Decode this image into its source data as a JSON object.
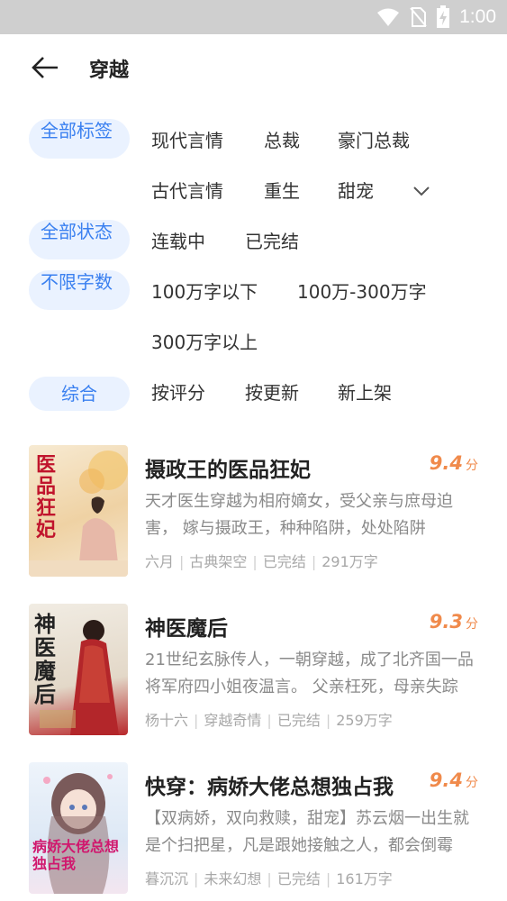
{
  "status_bar": {
    "time": "1:00"
  },
  "header": {
    "title": "穿越"
  },
  "filters": {
    "tags": {
      "label": "全部标签",
      "options": [
        "现代言情",
        "总裁",
        "豪门总裁",
        "古代言情",
        "重生",
        "甜宠"
      ]
    },
    "status": {
      "label": "全部状态",
      "options": [
        "连载中",
        "已完结"
      ]
    },
    "words": {
      "label": "不限字数",
      "options": [
        "100万字以下",
        "100万-300万字",
        "300万字以上"
      ]
    },
    "sort": {
      "label": "综合",
      "options": [
        "按评分",
        "按更新",
        "新上架"
      ]
    }
  },
  "books": [
    {
      "title": "摄政王的医品狂妃",
      "score": "9.4",
      "score_unit": "分",
      "desc": "天才医生穿越为相府嫡女，受父亲与庶母迫害， 嫁与摄政王，种种陷阱，处处陷阱",
      "author": "六月",
      "category": "古典架空",
      "status": "已完结",
      "words": "291万字",
      "cover_text": "医品狂妃",
      "cover_bg": "#f3e3c8"
    },
    {
      "title": "神医魔后",
      "score": "9.3",
      "score_unit": "分",
      "desc": "21世纪玄脉传人，一朝穿越，成了北齐国一品将军府四小姐夜温言。 父亲枉死，母亲失踪",
      "author": "杨十六",
      "category": "穿越奇情",
      "status": "已完结",
      "words": "259万字",
      "cover_text": "神医魔后",
      "cover_bg": "#e9e2d6"
    },
    {
      "title": "快穿：病娇大佬总想独占我",
      "score": "9.4",
      "score_unit": "分",
      "desc": "【双病娇，双向救赎，甜宠】苏云烟一出生就是个扫把星，凡是跟她接触之人，都会倒霉",
      "author": "暮沉沉",
      "category": "未来幻想",
      "status": "已完结",
      "words": "161万字",
      "cover_text": "病娇大佬总想独占我",
      "cover_bg": "#e6eef8"
    }
  ],
  "colors": {
    "accent": "#3a80f0",
    "pill_bg": "#eaf2ff",
    "score": "#f08a4b",
    "status_bar": "#cfcfcf"
  }
}
